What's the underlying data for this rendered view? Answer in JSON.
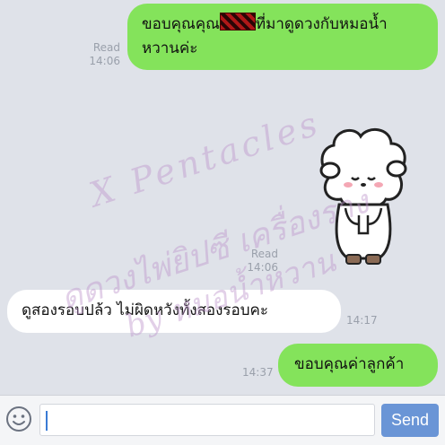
{
  "messages": [
    {
      "id": "m1",
      "direction": "out",
      "text_line1": "ขอบคุณคุณ",
      "redacted_label": "[redacted]",
      "text_line1b": "ที่มาดูดวงกับหมอน้ำ",
      "text_line2": "หวานค่ะ",
      "read": "Read",
      "time": "14:06"
    },
    {
      "id": "m2",
      "direction": "out",
      "type": "sticker",
      "sticker_name": "sheep-bow-sticker",
      "read": "Read",
      "time": "14:06"
    },
    {
      "id": "m3",
      "direction": "in",
      "text": "ดูสองรอบปล้ว  ไม่ผิดหวังทั้งสองรอบคะ",
      "time": "14:17"
    },
    {
      "id": "m4",
      "direction": "out",
      "text": "ขอบคุณค่าลูกค้า",
      "time": "14:37"
    }
  ],
  "watermark": {
    "line1": "X Pentacles",
    "line2": "ดูดวงไพ่ยิปซี เครื่องราง",
    "line3": "by หมอน้ำหวาน"
  },
  "input": {
    "placeholder": "",
    "value": ""
  },
  "send_label": "Send",
  "icons": {
    "emoji": "smiley-icon"
  },
  "colors": {
    "outgoing": "#84e35b",
    "incoming": "#ffffff",
    "background": "#dfe2e9",
    "send": "#6a95d6"
  }
}
